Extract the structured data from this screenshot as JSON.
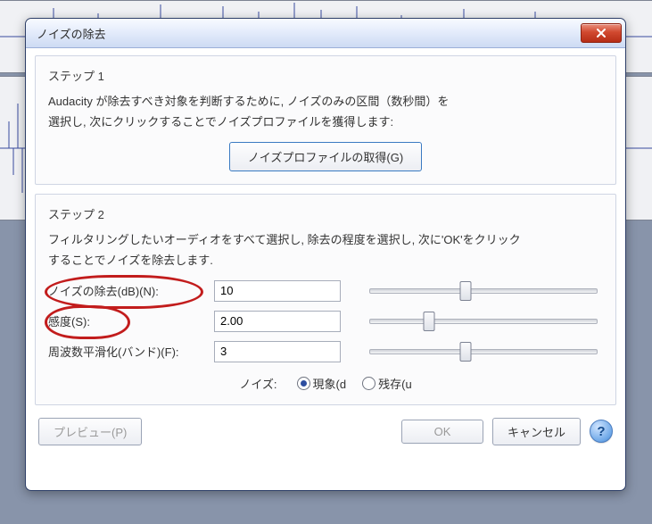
{
  "dialog": {
    "title": "ノイズの除去"
  },
  "step1": {
    "label": "ステップ 1",
    "desc_line1": "Audacity が除去すべき対象を判断するために, ノイズのみの区間（数秒間）を",
    "desc_line2": "選択し, 次にクリックすることでノイズプロファイルを獲得します:",
    "get_profile_label": "ノイズプロファイルの取得(G)"
  },
  "step2": {
    "label": "ステップ 2",
    "desc_line1": "フィルタリングしたいオーディオをすべて選択し, 除去の程度を選択し, 次に'OK'をクリック",
    "desc_line2": "することでノイズを除去します.",
    "params": {
      "noise_removal": {
        "label": "ノイズの除去(dB)(N):",
        "value": "10"
      },
      "sensitivity": {
        "label": "感度(S):",
        "value": "2.00"
      },
      "smoothing": {
        "label": "周波数平滑化(バンド)(F):",
        "value": "3"
      }
    },
    "noise_radio": {
      "label": "ノイズ:",
      "option_phenomenon": "現象(d",
      "option_residual": "残存(u",
      "selected": "phenomenon"
    }
  },
  "buttons": {
    "preview": "プレビュー(P)",
    "ok": "OK",
    "cancel": "キャンセル",
    "help": "?"
  }
}
